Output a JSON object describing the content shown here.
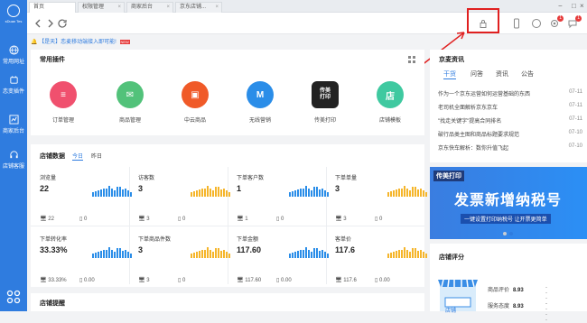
{
  "nav": {
    "logo_text": "sDuan Tes",
    "items": [
      {
        "label": "常用网址",
        "icon": "globe-icon"
      },
      {
        "label": "恋变插件",
        "icon": "plugin-icon"
      },
      {
        "label": "商家后台",
        "icon": "chart-icon"
      },
      {
        "label": "店铺客服",
        "icon": "headset-icon"
      }
    ]
  },
  "tabs": [
    "首页",
    "权限管理",
    "商家后台",
    "京东店铺..."
  ],
  "notice": {
    "text": "【是天】恋麦移动端接入即可能!",
    "badge": "NEW"
  },
  "plugins": {
    "title": "常用插件",
    "items": [
      {
        "label": "订单管理",
        "color": "#f0506e",
        "glyph": "≡"
      },
      {
        "label": "商品管理",
        "color": "#52c27a",
        "glyph": "✉"
      },
      {
        "label": "中云商品",
        "color": "#f05a28",
        "glyph": "▣"
      },
      {
        "label": "无线营销",
        "color": "#2a8de8",
        "glyph": "M"
      },
      {
        "label": "传美打印",
        "color": "#222222",
        "glyph": "传美打印"
      },
      {
        "label": "店铺模板",
        "color": "#3fc9a0",
        "glyph": "店"
      }
    ]
  },
  "stats": {
    "title": "店铺数据",
    "tabs": [
      "今日",
      "昨日"
    ],
    "metrics": [
      {
        "name": "浏览量",
        "value": "22",
        "pc": "22",
        "mobile": "0",
        "color": "#2a8de8"
      },
      {
        "name": "访客数",
        "value": "3",
        "pc": "3",
        "mobile": "0",
        "color": "#f5b52a"
      },
      {
        "name": "下单客户数",
        "value": "1",
        "pc": "1",
        "mobile": "0",
        "color": "#2a8de8"
      },
      {
        "name": "下单单量",
        "value": "3",
        "pc": "3",
        "mobile": "0",
        "color": "#f5b52a"
      },
      {
        "name": "下单转化率",
        "value": "33.33%",
        "pc": "33.33%",
        "mobile": "0.00",
        "color": "#2a8de8"
      },
      {
        "name": "下单商品件数",
        "value": "3",
        "pc": "3",
        "mobile": "0",
        "color": "#f5b52a"
      },
      {
        "name": "下单金额",
        "value": "117.60",
        "pc": "117.60",
        "mobile": "0.00",
        "color": "#2a8de8"
      },
      {
        "name": "客单价",
        "value": "117.6",
        "pc": "117.6",
        "mobile": "0.00",
        "color": "#f5b52a"
      }
    ]
  },
  "reminder": {
    "title": "店铺提醒"
  },
  "news": {
    "title": "京麦资讯",
    "tabs": [
      "干货",
      "问答",
      "资讯",
      "公告"
    ],
    "rows": [
      {
        "text": "作为一个京东运营如何运营基础的东西",
        "date": "07-11"
      },
      {
        "text": "老司机全面解析京东京车",
        "date": "07-11"
      },
      {
        "text": "\"找走关键字\"提高合同排名",
        "date": "07-11"
      },
      {
        "text": "破行品类主图和商品标题要求规范",
        "date": "07-10"
      },
      {
        "text": "京东快车解析：数你升值飞起",
        "date": "07-10"
      }
    ]
  },
  "banner": {
    "tag": "传美打印",
    "headline": "发票新增纳税号",
    "sub": "一键设置打印纳税号 让开票更简单"
  },
  "score": {
    "title": "店铺评分",
    "shop_label": "店铺",
    "rows": [
      {
        "label": "商品评价",
        "value": "8.93",
        "trend": "----"
      },
      {
        "label": "服务态度",
        "value": "8.93",
        "trend": "----"
      }
    ]
  },
  "toolbar": {
    "badge_a": "1",
    "badge_b": "1"
  }
}
